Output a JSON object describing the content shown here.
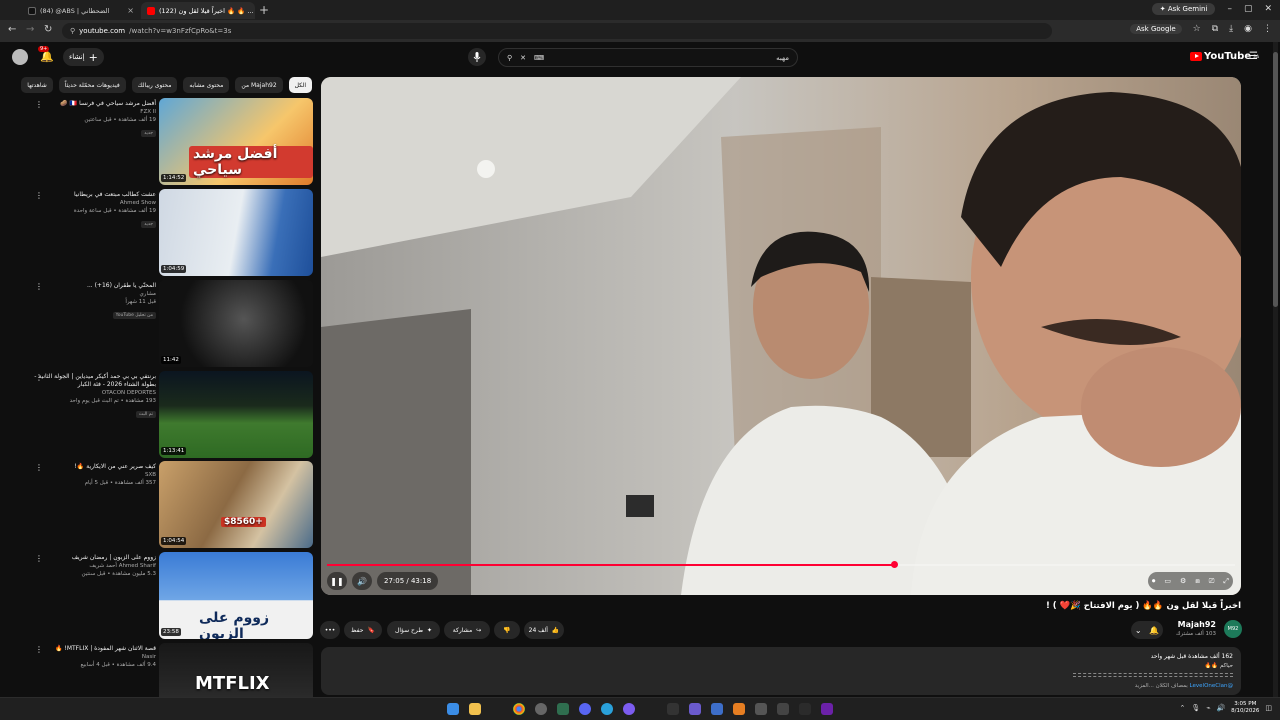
{
  "browser": {
    "tabs": [
      {
        "title": "(84) @ABS | الضحطاني",
        "active": false
      },
      {
        "title": "(122) اخيراً قيلا لقل ون 🔥 🔥 ...",
        "active": true
      }
    ],
    "new_tab": "+",
    "ask_gemini": "Ask Gemini",
    "url_host": "youtube.com",
    "url_path": "/watch?v=w3nFzfCpRo&t=3s",
    "ask_google": "Ask Google"
  },
  "youtube": {
    "notification_count": "9+",
    "create_label": "إنشاء",
    "search_query": "مهبه",
    "logo_text": "YouTube",
    "logo_region": "SA"
  },
  "chips": [
    "الكل",
    "من Majah92",
    "محتوى مشابه",
    "محتوى ريبالك",
    "فيديوهات محمّلة حديثاً",
    "شاهدتها"
  ],
  "recommendations": [
    {
      "title": "أفضل مرشد سياحي في فرنسا 🇫🇷 🥔",
      "channel": "FZX II",
      "stats": "19 ألف مشاهدة • قبل ساعتين",
      "badge": "جديد",
      "duration": "1:14:52",
      "thumb_text": "أفضل مرشد سياحي"
    },
    {
      "title": "عشت كطالب مبتعث في بريطانيا",
      "channel": "Ahmed Show",
      "stats": "19 ألف مشاهدة • قبل ساعة واحدة",
      "badge": "جديد",
      "duration": "1:04:59",
      "thumb_text": ""
    },
    {
      "title": "المحنّي يا طقران (16+) ...",
      "channel": "مشاري",
      "stats": "قبل 11 شهراً",
      "badge": "من تحليل YouTube",
      "duration": "11:42",
      "thumb_text": ""
    },
    {
      "title": "برنتفي بي بي حمد أكيكر ميدياين | الجولة الثانية - بطولة الشتاء 2026 - فئة الكبار",
      "channel": "OTACON DEPORTES",
      "stats": "193 مشاهدة • تم البث قبل يوم واحد",
      "badge": "تم البث",
      "duration": "1:13:41",
      "thumb_text": ""
    },
    {
      "title": "كيف صرير عني من الايكارية 🔥!",
      "channel": "SXB",
      "stats": "357 ألف مشاهدة • قبل 5 أيام",
      "badge": "",
      "duration": "1:04:54",
      "thumb_text": "$8560+"
    },
    {
      "title": "زووم على الزبون | رمضان شريف",
      "channel": "Ahmed Sharif أحمد شريف",
      "stats": "5.3 مليون مشاهدة • قبل سنتين",
      "badge": "",
      "duration": "23:58",
      "thumb_text": "زووم على الزبون"
    },
    {
      "title": "قصة الاثنان شهر المفودة | MTFLIX! 🔥",
      "channel": "Nasir",
      "stats": "9.4 ألف مشاهدة • قبل 4 أسابيع",
      "badge": "",
      "duration": "",
      "thumb_text": "MTFLIX"
    }
  ],
  "player": {
    "current_time": "27:05",
    "duration": "43:18",
    "time_display": "27:05 / 43:18",
    "progress": 0.625,
    "buffered": 0.64
  },
  "video": {
    "title": "اخيراً قيلا لقل ون 🔥🔥 ( يوم الافتتاح 🎉❤️ ) !",
    "channel_name": "Majah92",
    "channel_initials": "M92",
    "subscribers": "103 ألف مشترك",
    "likes": "24 ألف",
    "share_label": "مشاركة",
    "ask_label": "طرح سؤال",
    "save_label": "حفظ",
    "more_label": "•••"
  },
  "description": {
    "stats": "162 ألف مشاهدة قبل شهر واحد",
    "line2": "حياكم 🔥🔥",
    "hashtags_prefix": "@LevelOneClan",
    "line3_suffix": "بمصاف الكلان ...المزيد"
  },
  "taskbar": {
    "time": "3:05 PM",
    "date": "8/10/2026"
  },
  "colors": {
    "accent_red": "#ff0033",
    "background": "#0f0f0f",
    "surface": "#272727"
  }
}
